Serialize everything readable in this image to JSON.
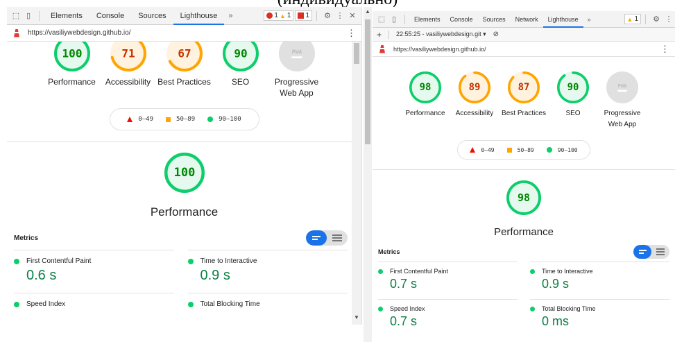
{
  "caption": "(индивидуально)",
  "colors": {
    "pass": "#0cce6b",
    "average": "#ffa400",
    "fail": "#eb0f00",
    "pwa": "#9e9e9e"
  },
  "left": {
    "tabs": [
      "Elements",
      "Console",
      "Sources",
      "Lighthouse"
    ],
    "active_tab": "Lighthouse",
    "more": "»",
    "errors": "1",
    "warnings": "1",
    "issues": "1",
    "url": "https://vasiliywebdesign.github.io/",
    "categories": [
      {
        "label": "Performance",
        "score": "100",
        "value": 100,
        "status": "pass"
      },
      {
        "label": "Accessibility",
        "score": "71",
        "value": 71,
        "status": "average"
      },
      {
        "label": "Best Practices",
        "score": "67",
        "value": 67,
        "status": "average"
      },
      {
        "label": "SEO",
        "score": "90",
        "value": 90,
        "status": "pass"
      },
      {
        "label": "Progressive Web App",
        "score": "PWA",
        "value": 0,
        "status": "pwa"
      }
    ],
    "legend": [
      "0–49",
      "50–89",
      "90–100"
    ],
    "perf_score": "100",
    "perf_value": 100,
    "perf_title": "Performance",
    "metrics_title": "Metrics",
    "metrics": [
      {
        "name": "First Contentful Paint",
        "value": "0.6 s"
      },
      {
        "name": "Time to Interactive",
        "value": "0.9 s"
      },
      {
        "name": "Speed Index",
        "value": ""
      },
      {
        "name": "Total Blocking Time",
        "value": ""
      }
    ]
  },
  "right": {
    "tabs": [
      "Elements",
      "Console",
      "Sources",
      "Network",
      "Lighthouse"
    ],
    "active_tab": "Lighthouse",
    "more": "»",
    "warnings": "1",
    "report_select": "22:55:25 - vasiliywebdesign.git",
    "url": "https://vasiliywebdesign.github.io/",
    "categories": [
      {
        "label": "Performance",
        "score": "98",
        "value": 98,
        "status": "pass"
      },
      {
        "label": "Accessibility",
        "score": "89",
        "value": 89,
        "status": "average"
      },
      {
        "label": "Best Practices",
        "score": "87",
        "value": 87,
        "status": "average"
      },
      {
        "label": "SEO",
        "score": "90",
        "value": 90,
        "status": "pass"
      },
      {
        "label": "Progressive Web App",
        "score": "PWA",
        "value": 0,
        "status": "pwa"
      }
    ],
    "legend": [
      "0–49",
      "50–89",
      "90–100"
    ],
    "perf_score": "98",
    "perf_value": 98,
    "perf_title": "Performance",
    "metrics_title": "Metrics",
    "metrics": [
      {
        "name": "First Contentful Paint",
        "value": "0.7 s"
      },
      {
        "name": "Time to Interactive",
        "value": "0.9 s"
      },
      {
        "name": "Speed Index",
        "value": "0.7 s"
      },
      {
        "name": "Total Blocking Time",
        "value": "0 ms"
      }
    ]
  }
}
